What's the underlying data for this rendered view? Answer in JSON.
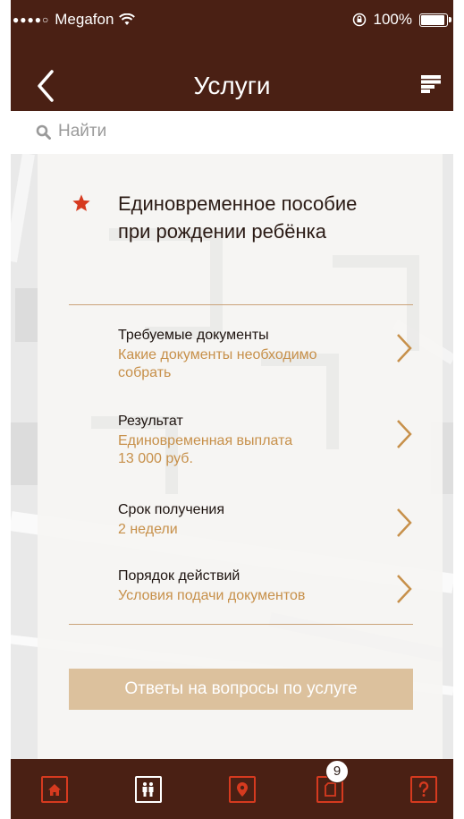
{
  "status_bar": {
    "signal": "●●●●○",
    "carrier": "Megafon",
    "battery": "100%"
  },
  "nav": {
    "title": "Услуги"
  },
  "search": {
    "placeholder": "Найти"
  },
  "service": {
    "title_line1": "Единовременное пособие",
    "title_line2": "при рождении ребёнка",
    "items": [
      {
        "label": "Требуемые документы",
        "value_line1": "Какие документы необходимо",
        "value_line2": "собрать"
      },
      {
        "label": "Результат",
        "value_line1": "Единовременная выплата",
        "value_line2": "13 000 руб."
      },
      {
        "label": "Срок получения",
        "value_line1": "2 недели",
        "value_line2": ""
      },
      {
        "label": "Порядок действий",
        "value_line1": "Условия подачи документов",
        "value_line2": ""
      }
    ],
    "cta_label": "Ответы на вопросы по услуге"
  },
  "tabbar": {
    "badge_count": "9",
    "tabs": [
      "home-icon",
      "queue-icon",
      "map-pin-icon",
      "documents-icon",
      "help-icon"
    ]
  },
  "colors": {
    "header_bg": "#4a2014",
    "accent": "#c7904a",
    "star": "#d63a1f",
    "cta_bg": "#dcc19d"
  }
}
